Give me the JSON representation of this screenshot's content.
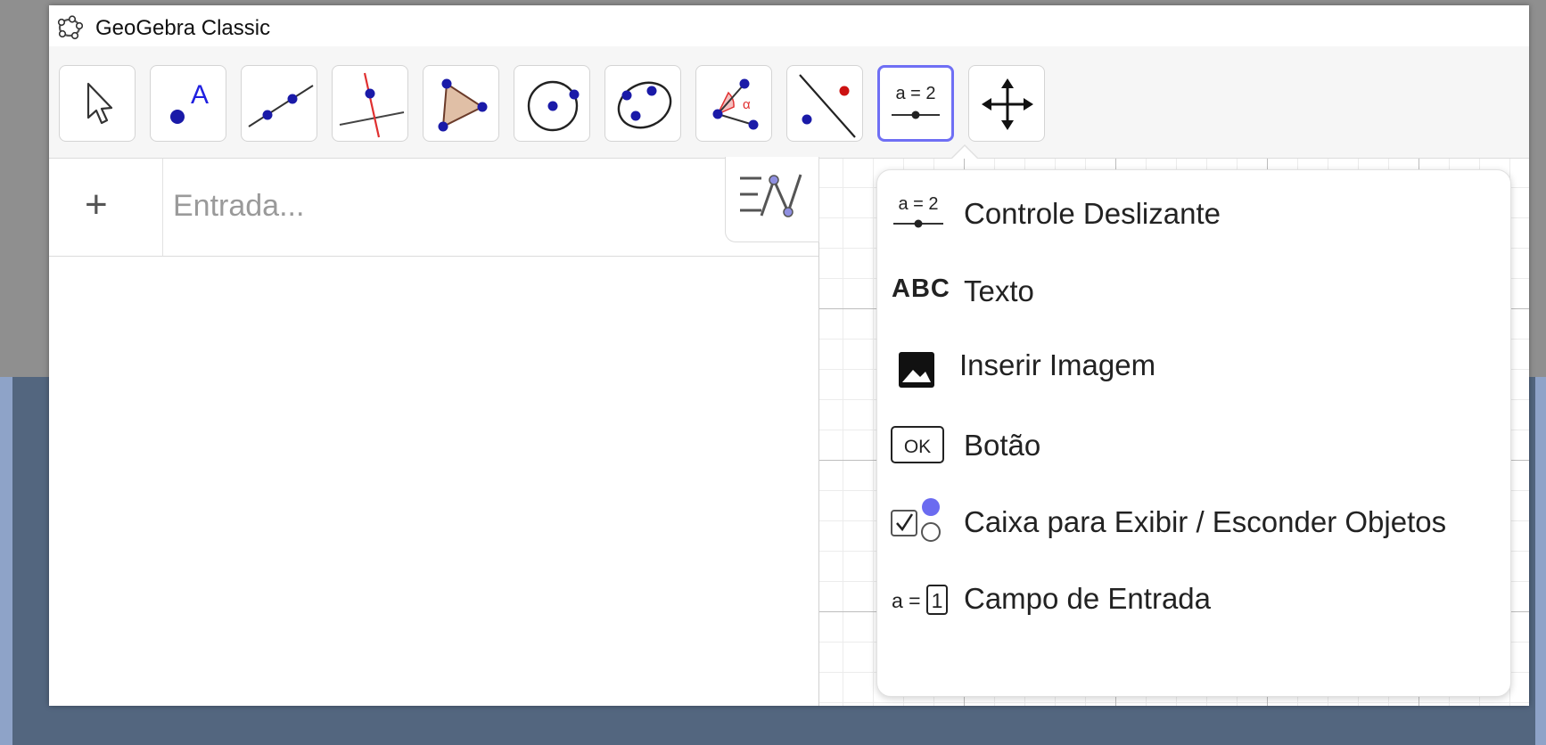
{
  "window": {
    "title": "GeoGebra Classic"
  },
  "toolbar": {
    "tools": [
      {
        "name": "move",
        "icon": "arrow-cursor-icon"
      },
      {
        "name": "point",
        "icon": "point-icon",
        "text": "A"
      },
      {
        "name": "line",
        "icon": "line-icon"
      },
      {
        "name": "perpendicular-line",
        "icon": "perpendicular-line-icon"
      },
      {
        "name": "polygon",
        "icon": "polygon-icon"
      },
      {
        "name": "circle",
        "icon": "circle-center-point-icon"
      },
      {
        "name": "conic",
        "icon": "ellipse-icon"
      },
      {
        "name": "angle",
        "icon": "angle-icon",
        "text": "α"
      },
      {
        "name": "reflect",
        "icon": "reflect-about-line-icon"
      },
      {
        "name": "slider",
        "icon": "slider-icon",
        "text": "a = 2",
        "active": true
      },
      {
        "name": "move-graphics-view",
        "icon": "move-view-icon"
      }
    ],
    "active_color": "#6f6ff4"
  },
  "algebra": {
    "add_label": "+",
    "input_placeholder": "Entrada..."
  },
  "dropdown": {
    "items": [
      {
        "label": "Controle Deslizante",
        "icon": "slider-icon",
        "icon_text": "a = 2"
      },
      {
        "label": "Texto",
        "icon": "text-icon",
        "icon_text": "ABC"
      },
      {
        "label": "Inserir Imagem",
        "icon": "image-icon"
      },
      {
        "label": "Botão",
        "icon": "button-icon",
        "icon_text": "OK"
      },
      {
        "label": "Caixa para Exibir / Esconder Objetos",
        "icon": "checkbox-icon"
      },
      {
        "label": "Campo de Entrada",
        "icon": "input-box-icon",
        "icon_text": "a =",
        "icon_value": "1"
      }
    ]
  },
  "colors": {
    "point_blue": "#1a1aa8",
    "line_red": "#e03030",
    "polygon_fill": "#e0bfa6",
    "accent": "#6f6ff4"
  }
}
